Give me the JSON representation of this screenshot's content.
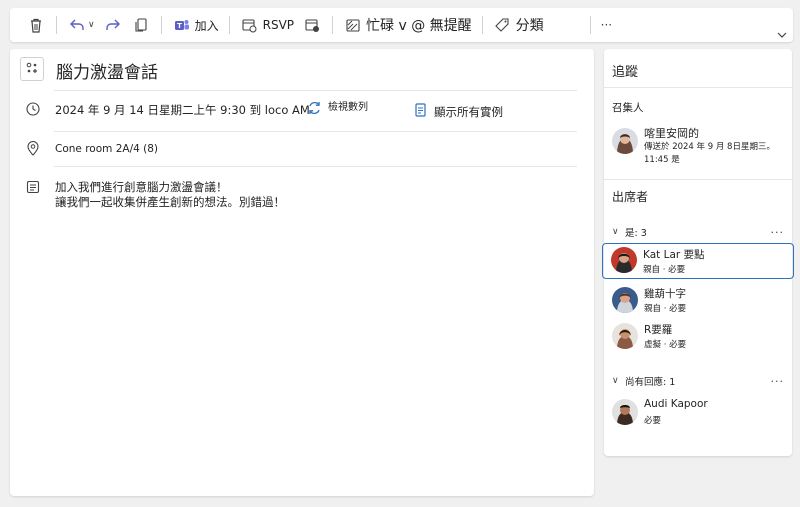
{
  "toolbar": {
    "join_label": "加入",
    "rsvp_label": "RSVP",
    "status_label": "忙碌 v @ 無提醒",
    "categorize_label": "分類",
    "more_label": "···"
  },
  "event": {
    "title": "腦力激盪會話",
    "datetime": "2024 年 9 月 14 日星期二上午 9:30 到 loco AM",
    "view_series": "檢視數列",
    "show_all": "顯示所有實例",
    "location": "Cone room 2A/4 (8)",
    "body_line1": "加入我們進行創意腦力激盪會議！",
    "body_line2": "讓我們一起收集併產生創新的想法。別錯過！"
  },
  "tracking": {
    "heading": "追蹤",
    "organizer_label": "召集人",
    "organizer": {
      "name": "喀里安岡的",
      "sent": "傳送於 2024 年 9 月 8日星期三。",
      "time": "11:45 是"
    },
    "attendees_heading": "出席者",
    "group_yes": "是: 3",
    "group_noreply": "尚有回應: 1",
    "more": "···",
    "attendees": [
      {
        "name": "Kat Lar 要點",
        "role": "親自 · 必要",
        "color": "#c0392b"
      },
      {
        "name": "雞葫十字",
        "role": "親自 · 必要",
        "color": "#3b5b8c"
      },
      {
        "name": "R要羅",
        "role": "虛擬 · 必要",
        "color": "#8a5a44"
      }
    ],
    "noreply": [
      {
        "name": "Audi Kapoor",
        "role": "必要",
        "color": "#3d2b22"
      }
    ]
  }
}
